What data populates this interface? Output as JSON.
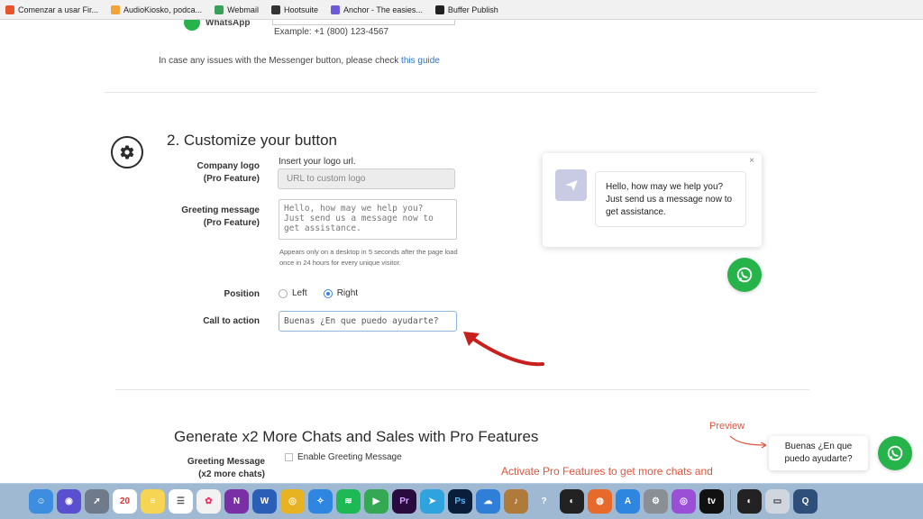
{
  "bookmarks": [
    {
      "label": "Comenzar a usar Fir...",
      "color": "#e8552b"
    },
    {
      "label": "AudioKiosko, podca...",
      "color": "#f2a33a"
    },
    {
      "label": "Webmail",
      "color": "#3aa05a"
    },
    {
      "label": "Hootsuite",
      "color": "#333333"
    },
    {
      "label": "Anchor - The easies...",
      "color": "#6b5bd6"
    },
    {
      "label": "Buffer Publish",
      "color": "#222222"
    }
  ],
  "top_section": {
    "whatsapp_label": "WhatsApp",
    "phone_example": "Example: +1 (800) 123-4567",
    "issue_text": "In case any issues with the Messenger button, please check ",
    "issue_link": "this guide"
  },
  "customize": {
    "title": "2. Customize your button",
    "company_logo_label": "Company logo",
    "company_logo_pro": "(Pro Feature)",
    "logo_hint": "Insert your logo url.",
    "logo_placeholder": "URL to custom logo",
    "greeting_label": "Greeting message",
    "greeting_pro": "(Pro Feature)",
    "greeting_value": "Hello, how may we help you?\nJust send us a message now to\nget assistance.",
    "greeting_note": "Appears only on a desktop in 5 seconds after the page load once in 24 hours for every unique visitor.",
    "position_label": "Position",
    "position_left": "Left",
    "position_right": "Right",
    "position_selected": "Right",
    "cta_label": "Call to action",
    "cta_value": "Buenas ¿En que puedo ayudarte?"
  },
  "preview_popup": {
    "close": "×",
    "message": "Hello, how may we help you? Just send us a message now to get assistance."
  },
  "pro_section": {
    "title": "Generate x2 More Chats and Sales with Pro Features",
    "preview_label": "Preview",
    "cta_bubble": "Buenas ¿En que puedo ayudarte?",
    "greeting_message_label": "Greeting Message",
    "greeting_message_sub": "(x2 more chats)",
    "enable_greeting": "Enable Greeting Message",
    "activate_text": "Activate Pro Features to get more chats and"
  },
  "dock": [
    {
      "name": "finder",
      "color": "#3d8ee0",
      "glyph": "☺"
    },
    {
      "name": "siri",
      "color": "#5a4fcf",
      "glyph": "◉"
    },
    {
      "name": "launchpad",
      "color": "#6f7b8a",
      "glyph": "➚"
    },
    {
      "name": "calendar",
      "color": "#ffffff",
      "glyph": "20",
      "text": "#d33"
    },
    {
      "name": "notes",
      "color": "#f5d553",
      "glyph": "≡"
    },
    {
      "name": "reminders",
      "color": "#ffffff",
      "glyph": "☰",
      "text": "#555"
    },
    {
      "name": "photos",
      "color": "#f2f2f2",
      "glyph": "✿",
      "text": "#e36"
    },
    {
      "name": "onenote",
      "color": "#7b2fa6",
      "glyph": "N"
    },
    {
      "name": "word",
      "color": "#2b5fb7",
      "glyph": "W"
    },
    {
      "name": "chrome",
      "color": "#e8b323",
      "glyph": "◎"
    },
    {
      "name": "safari",
      "color": "#2f86e0",
      "glyph": "✧"
    },
    {
      "name": "spotify",
      "color": "#1db954",
      "glyph": "≋"
    },
    {
      "name": "facetime",
      "color": "#34a853",
      "glyph": "▶"
    },
    {
      "name": "premiere",
      "color": "#2a0b3f",
      "glyph": "Pr",
      "text": "#d6a6ff"
    },
    {
      "name": "telegram",
      "color": "#2fa3dd",
      "glyph": "➤"
    },
    {
      "name": "photoshop",
      "color": "#0a1d3a",
      "glyph": "Ps",
      "text": "#4fb6ff"
    },
    {
      "name": "onedrive",
      "color": "#2f7fd8",
      "glyph": "☁"
    },
    {
      "name": "garageband",
      "color": "#b07a3a",
      "glyph": "♪"
    },
    {
      "name": "help",
      "color": "#9fb9d3",
      "glyph": "?"
    },
    {
      "name": "obs",
      "color": "#222222",
      "glyph": "◐"
    },
    {
      "name": "firefox",
      "color": "#e86a2b",
      "glyph": "◍"
    },
    {
      "name": "appstore",
      "color": "#2f86e0",
      "glyph": "A"
    },
    {
      "name": "preferences",
      "color": "#8a8f96",
      "glyph": "⚙"
    },
    {
      "name": "podcasts",
      "color": "#9b4fd6",
      "glyph": "◎"
    },
    {
      "name": "appletv",
      "color": "#111111",
      "glyph": "tv"
    },
    {
      "name": "obs-2",
      "color": "#222222",
      "glyph": "◐"
    },
    {
      "name": "screenshot",
      "color": "#cfd6de",
      "glyph": "▭",
      "text": "#333"
    },
    {
      "name": "quicktime",
      "color": "#2d4f7a",
      "glyph": "Q"
    }
  ]
}
